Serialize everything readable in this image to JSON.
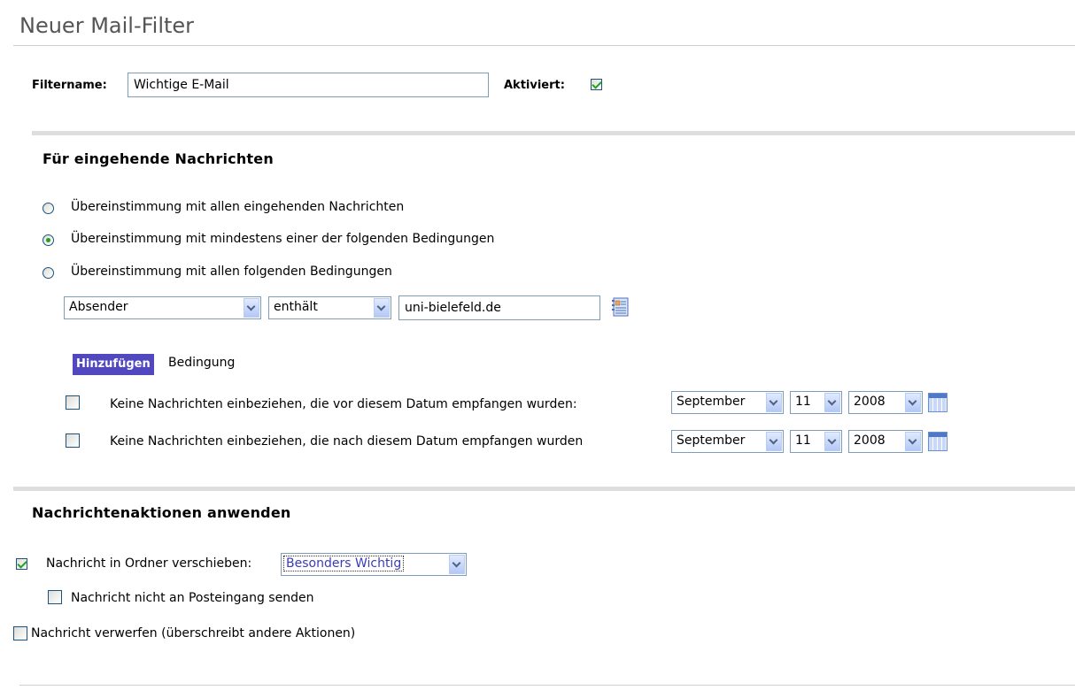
{
  "page_title": "Neuer Mail-Filter",
  "filter": {
    "name_label": "Filtername:",
    "name_value": "Wichtige E-Mail",
    "active_label": "Aktiviert:",
    "active_checked": true
  },
  "incoming": {
    "title": "Für eingehende Nachrichten",
    "options": [
      {
        "label": "Übereinstimmung mit allen eingehenden Nachrichten",
        "selected": false
      },
      {
        "label": "Übereinstimmung mit mindestens einer der folgenden Bedingungen",
        "selected": true
      },
      {
        "label": "Übereinstimmung mit allen folgenden Bedingungen",
        "selected": false
      }
    ],
    "condition": {
      "field": "Absender",
      "operator": "enthält",
      "value": "uni-bielefeld.de"
    },
    "add_button": "Hinzufügen",
    "add_suffix": "Bedingung",
    "date_rules": [
      {
        "label": "Keine Nachrichten einbeziehen, die vor diesem Datum empfangen wurden:",
        "checked": false,
        "month": "September",
        "day": "11",
        "year": "2008"
      },
      {
        "label": "Keine Nachrichten einbeziehen, die nach diesem Datum empfangen wurden",
        "checked": false,
        "month": "September",
        "day": "11",
        "year": "2008"
      }
    ]
  },
  "actions": {
    "title": "Nachrichtenaktionen anwenden",
    "move_label": "Nachricht in Ordner verschieben:",
    "move_checked": true,
    "folder": "Besonders Wichtig",
    "no_inbox_label": "Nachricht nicht an Posteingang senden",
    "no_inbox_checked": false,
    "discard_label": "Nachricht verwerfen (überschreibt andere Aktionen)",
    "discard_checked": false
  },
  "colors": {
    "accent_button": "#5148c0",
    "check": "#21a121",
    "section_band": "#dedede"
  }
}
